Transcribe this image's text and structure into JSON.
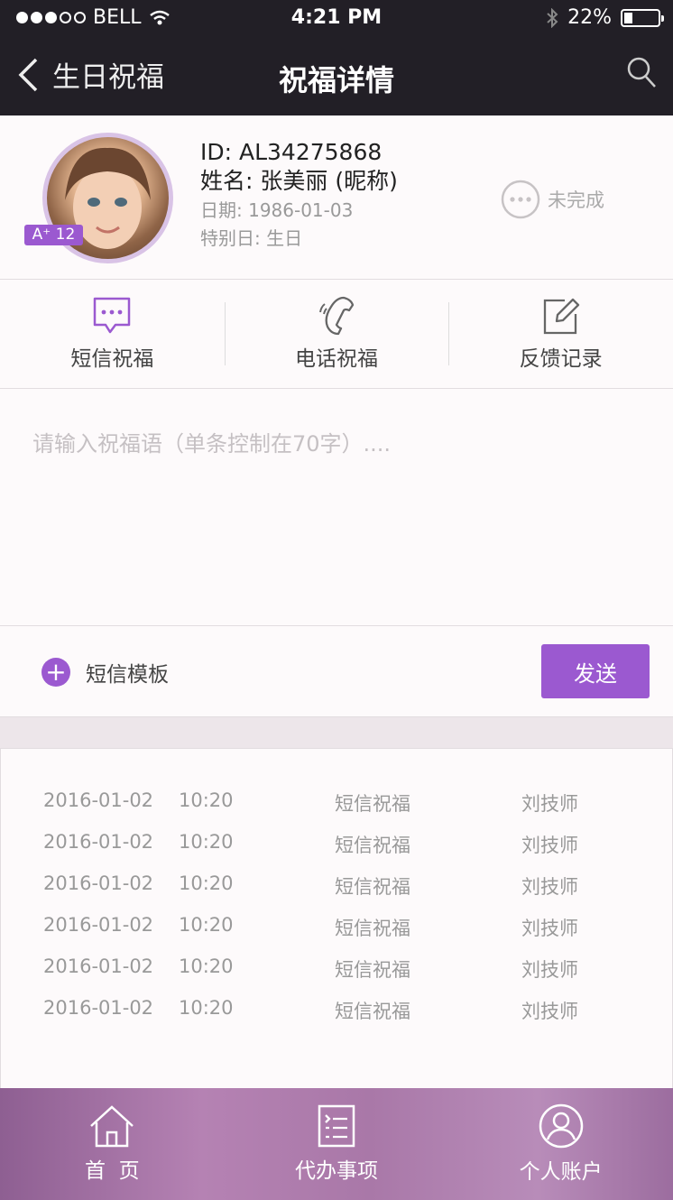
{
  "status_bar": {
    "carrier": "BELL",
    "time": "4:21 PM",
    "battery": "22%",
    "signal_filled": 3,
    "signal_total": 5,
    "battery_level": 0.22
  },
  "nav": {
    "back_label": "生日祝福",
    "title": "祝福详情"
  },
  "profile": {
    "id": "ID: AL34275868",
    "name": "姓名: 张美丽 (昵称)",
    "date": "日期: 1986-01-03",
    "special_day": "特别日: 生日",
    "level": "A⁺ 12",
    "status": "未完成"
  },
  "actions": [
    {
      "label": "短信祝福",
      "icon": "sms-icon"
    },
    {
      "label": "电话祝福",
      "icon": "phone-icon"
    },
    {
      "label": "反馈记录",
      "icon": "edit-icon"
    }
  ],
  "message_input": {
    "placeholder": "请输入祝福语（单条控制在70字）...."
  },
  "template": {
    "label": "短信模板"
  },
  "send_button": {
    "label": "发送"
  },
  "records": [
    {
      "date": "2016-01-02",
      "time": "10:20",
      "type": "短信祝福",
      "person": "刘技师"
    },
    {
      "date": "2016-01-02",
      "time": "10:20",
      "type": "短信祝福",
      "person": "刘技师"
    },
    {
      "date": "2016-01-02",
      "time": "10:20",
      "type": "短信祝福",
      "person": "刘技师"
    },
    {
      "date": "2016-01-02",
      "time": "10:20",
      "type": "短信祝福",
      "person": "刘技师"
    },
    {
      "date": "2016-01-02",
      "time": "10:20",
      "type": "短信祝福",
      "person": "刘技师"
    },
    {
      "date": "2016-01-02",
      "time": "10:20",
      "type": "短信祝福",
      "person": "刘技师"
    }
  ],
  "tabs": [
    {
      "label": "首  页",
      "icon": "home-icon"
    },
    {
      "label": "代办事项",
      "icon": "todo-list-icon"
    },
    {
      "label": "个人账户",
      "icon": "user-account-icon"
    }
  ],
  "colors": {
    "accent": "#9b59d0",
    "nav_bg": "#221f26"
  }
}
